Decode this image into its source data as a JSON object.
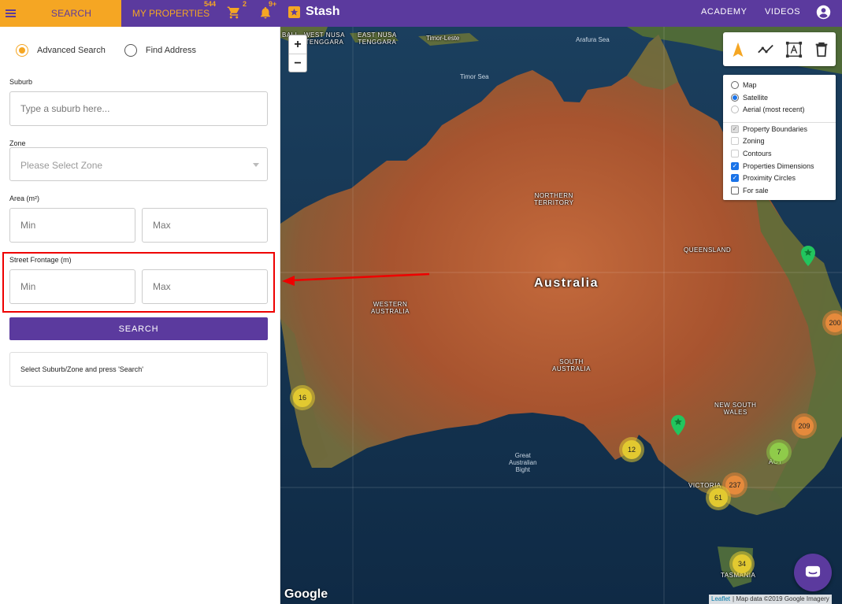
{
  "topbar": {
    "tab_search": "SEARCH",
    "tab_properties": "MY PROPERTIES",
    "properties_count": "544",
    "cart_count": "2",
    "notifications_count": "9+",
    "brand": "Stash",
    "nav_academy": "ACADEMY",
    "nav_videos": "VIDEOS"
  },
  "panel": {
    "radio_advanced": "Advanced Search",
    "radio_address": "Find Address",
    "suburb_label": "Suburb",
    "suburb_placeholder": "Type a suburb here...",
    "zone_label": "Zone",
    "zone_placeholder": "Please Select Zone",
    "area_label": "Area (m²)",
    "frontage_label": "Street Frontage (m)",
    "min_placeholder": "Min",
    "max_placeholder": "Max",
    "search_button": "SEARCH",
    "info_text": "Select Suburb/Zone and press 'Search'"
  },
  "map": {
    "zoom_in": "+",
    "zoom_out": "−",
    "base_layers": [
      "Map",
      "Satellite",
      "Aerial (most recent)"
    ],
    "overlays": [
      "Property Boundaries",
      "Zoning",
      "Contours",
      "Properties Dimensions",
      "Proximity Circles",
      "For sale"
    ],
    "country_label": "Australia",
    "region_labels": {
      "nt": "NORTHERN\nTERRITORY",
      "qld": "QUEENSLAND",
      "wa": "WESTERN\nAUSTRALIA",
      "sa": "SOUTH\nAUSTRALIA",
      "nsw": "NEW SOUTH\nWALES",
      "vic": "VICTORIA",
      "act": "ACT",
      "tas": "TASMANIA",
      "bali": "BALI",
      "west_nusa": "WEST NUSA\nTENGGARA",
      "east_nusa": "EAST NUSA\nTENGGARA",
      "timor_leste": "Timor-Leste"
    },
    "sea_labels": {
      "arafura": "Arafura Sea",
      "timor": "Timor Sea",
      "bight": "Great\nAustralian\nBight"
    },
    "clusters": {
      "c200": "200",
      "c16": "16",
      "c209": "209",
      "c12": "12",
      "c7": "7",
      "c237": "237",
      "c61": "61",
      "c34": "34"
    },
    "google_logo": "Google",
    "attribution_link": "Leaflet",
    "attribution_text": "| Map data ©2019 Google Imagery"
  },
  "colors": {
    "brand_purple": "#5b3a9e",
    "accent_orange": "#f5a623",
    "highlight_red": "#e00000"
  }
}
